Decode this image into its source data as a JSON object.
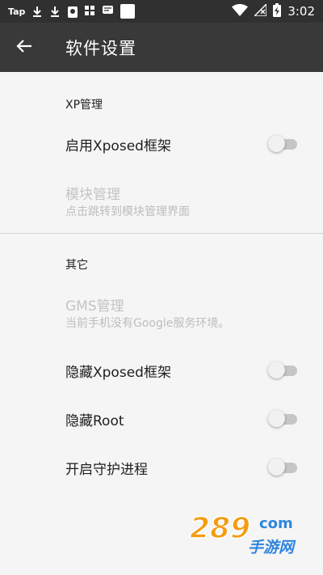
{
  "status_bar": {
    "app_badge": "Tap",
    "time": "3:02"
  },
  "app_bar": {
    "title": "软件设置",
    "back_icon": "arrow-back-icon"
  },
  "sections": {
    "xp": {
      "title": "XP管理",
      "enable_xposed": {
        "title": "启用Xposed框架",
        "checked": false
      },
      "module_manage": {
        "title": "模块管理",
        "summary": "点击跳转到模块管理界面",
        "enabled": false
      }
    },
    "other": {
      "title": "其它",
      "gms_manage": {
        "title": "GMS管理",
        "summary": "当前手机没有Google服务环境。",
        "enabled": false
      },
      "hide_xposed": {
        "title": "隐藏Xposed框架",
        "checked": false
      },
      "hide_root": {
        "title": "隐藏Root",
        "checked": false
      },
      "daemon": {
        "title": "开启守护进程",
        "checked": false
      }
    }
  },
  "watermark": {
    "number": "289",
    "site": "com",
    "text": "手游网"
  },
  "colors": {
    "status_bar": "#303030",
    "app_bar": "#393939",
    "background": "#f5f5f5",
    "switch_track_off": "#c6c6c6",
    "watermark_orange": "#f39c12",
    "watermark_blue": "#2e86de"
  }
}
